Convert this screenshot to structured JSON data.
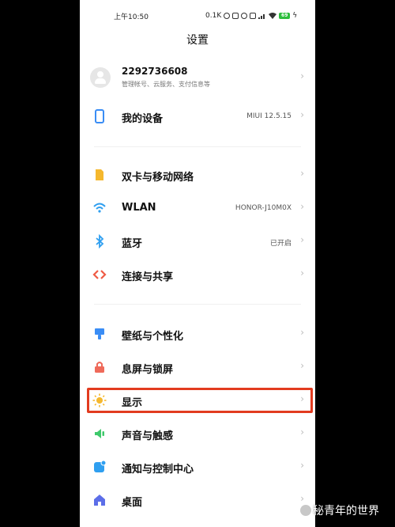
{
  "status_bar": {
    "time": "上午10:50",
    "speed": "0.1K",
    "battery": "69"
  },
  "title": "设置",
  "account": {
    "name": "2292736608",
    "subtitle": "管理帐号、云服务、支付信息等"
  },
  "items": [
    {
      "label": "我的设备",
      "value": "MIUI 12.5.15",
      "icon": "phone-device-icon",
      "color": "#3a8df5"
    },
    {
      "label": "双卡与移动网络",
      "value": "",
      "icon": "sim-card-icon",
      "color": "#f5b82e"
    },
    {
      "label": "WLAN",
      "value": "HONOR-J10M0X",
      "icon": "wifi-icon",
      "color": "#2f9ff0"
    },
    {
      "label": "蓝牙",
      "value": "已开启",
      "icon": "bluetooth-icon",
      "color": "#2f9ff0"
    },
    {
      "label": "连接与共享",
      "value": "",
      "icon": "connection-share-icon",
      "color": "#ef5a44"
    },
    {
      "label": "壁纸与个性化",
      "value": "",
      "icon": "wallpaper-icon",
      "color": "#3a8df5"
    },
    {
      "label": "息屏与锁屏",
      "value": "",
      "icon": "lock-icon",
      "color": "#ef6a5a"
    },
    {
      "label": "显示",
      "value": "",
      "icon": "brightness-icon",
      "color": "#f5b82e"
    },
    {
      "label": "声音与触感",
      "value": "",
      "icon": "speaker-icon",
      "color": "#3ec96b"
    },
    {
      "label": "通知与控制中心",
      "value": "",
      "icon": "notification-icon",
      "color": "#2f9ff0"
    },
    {
      "label": "桌面",
      "value": "",
      "icon": "home-icon",
      "color": "#5c6ee8"
    }
  ],
  "chevron": "›",
  "watermark": "秘青年的世界",
  "highlight_color": "#e23b1f"
}
